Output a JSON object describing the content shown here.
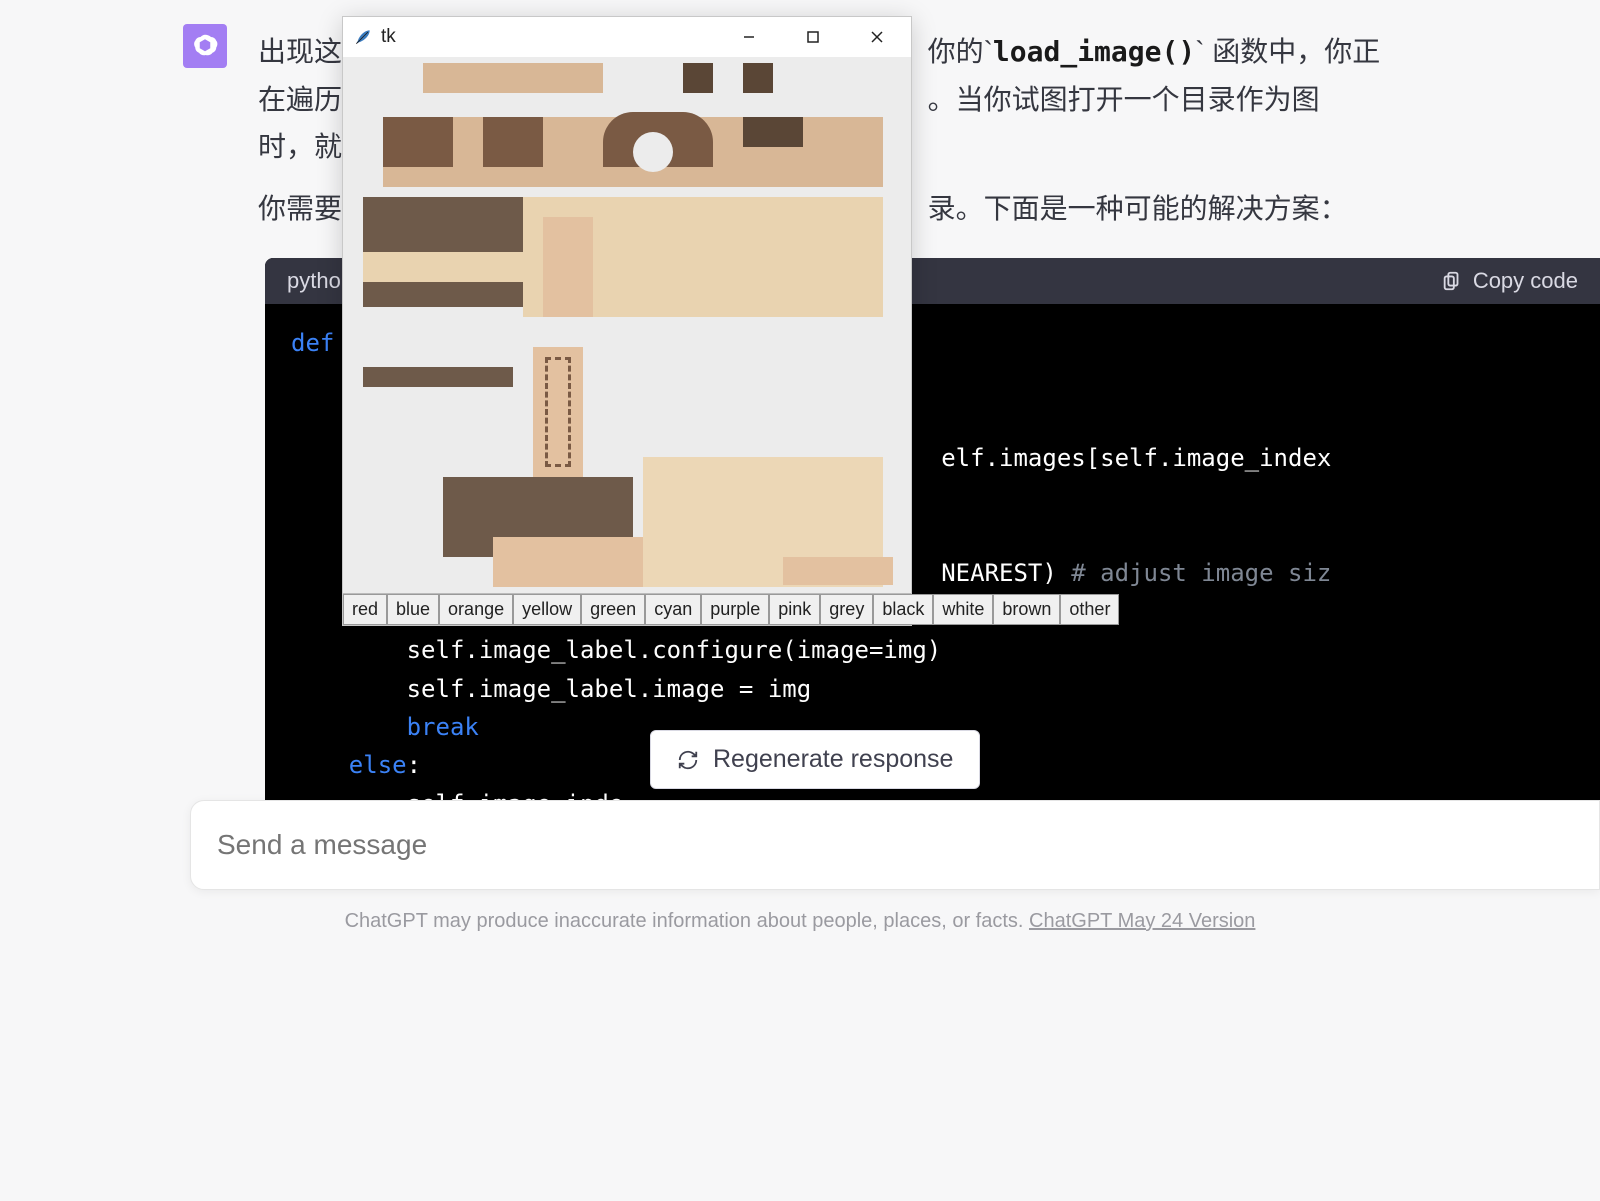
{
  "message": {
    "para1_prefix": "出现这",
    "para1_code": "load_image()",
    "para1_after_code": "` 函数中，你正",
    "para1_line2": "在遍历",
    "para1_line2_tail": "。当你试图打开一个目录作为图",
    "para1_line3": "时，就",
    "para2_prefix": "你需要",
    "para2_tail": "录。下面是一种可能的解决方案："
  },
  "code_header": {
    "lang": "python",
    "copy": "Copy code"
  },
  "code_lines": {
    "l1_kw": "def",
    "l2": "elf.images[self.image_index",
    "l3": "NEAREST) ",
    "l3_cm": "# adjust image siz",
    "l4": "        self.image_label.configure(image=img)",
    "l5": "        self.image_label.image = img",
    "l6_kw": "        break",
    "l7a": "    ",
    "l7_kw": "else",
    "l7b": ":",
    "l8": "        self.image_inde"
  },
  "regenerate_label": "Regenerate response",
  "input_placeholder": "Send a message",
  "footer_text": "ChatGPT may produce inaccurate information about people, places, or facts. ",
  "footer_link": "ChatGPT May 24 Version",
  "tk": {
    "title": "tk",
    "buttons": [
      "red",
      "blue",
      "orange",
      "yellow",
      "green",
      "cyan",
      "purple",
      "pink",
      "grey",
      "black",
      "white",
      "brown",
      "other"
    ]
  }
}
